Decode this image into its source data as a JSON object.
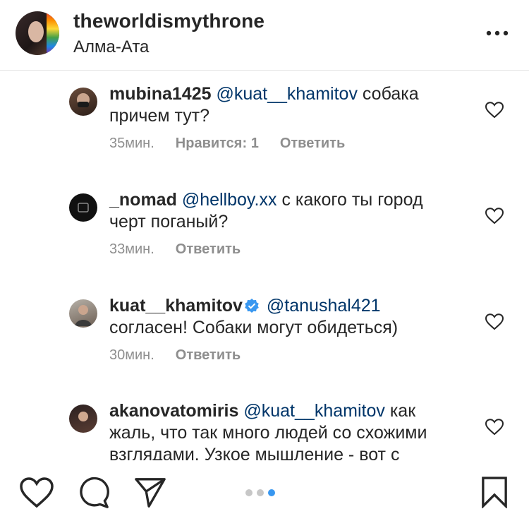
{
  "post": {
    "username": "theworldismythrone",
    "location": "Алма-Ата"
  },
  "comments": [
    {
      "username": "mubina1425",
      "mention": "@kuat__khamitov",
      "text": "собака причем тут?",
      "time": "35мин.",
      "likes": "Нравится: 1",
      "reply": "Ответить",
      "verified": false
    },
    {
      "username": "_nomad",
      "mention": "@hellboy.xx",
      "text": "с какого ты город черт поганый?",
      "time": "33мин.",
      "likes": "",
      "reply": "Ответить",
      "verified": false
    },
    {
      "username": "kuat__khamitov",
      "mention": "@tanushal421",
      "text": "согласен! Собаки могут обидеться)",
      "time": "30мин.",
      "likes": "",
      "reply": "Ответить",
      "verified": true
    },
    {
      "username": "akanovatomiris",
      "mention": "@kuat__khamitov",
      "text": "как жаль, что так много людей со схожими взглядами.  Узкое мышление - вот с",
      "time": "",
      "likes": "",
      "reply": "",
      "verified": false
    }
  ],
  "carousel": {
    "count": 3,
    "active_index": 2
  },
  "colors": {
    "text": "#262626",
    "muted": "#8e8e8e",
    "mention": "#003569",
    "verified": "#3897f0",
    "active_dot": "#3897f0"
  },
  "icons": {
    "more": "more-dots-icon",
    "heart": "heart-outline-icon",
    "comment": "comment-bubble-icon",
    "share": "paper-plane-icon",
    "save": "bookmark-outline-icon",
    "verified": "verified-badge-icon"
  }
}
